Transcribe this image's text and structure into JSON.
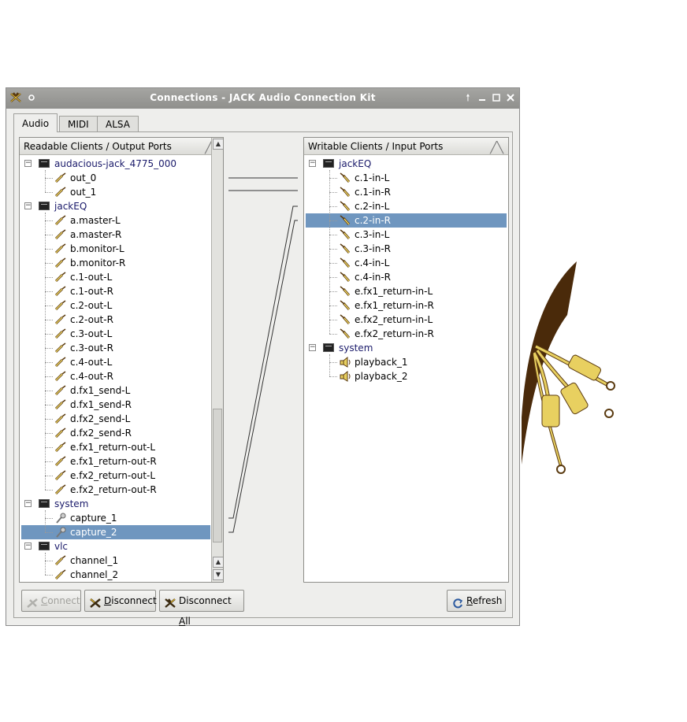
{
  "window": {
    "title": "Connections - JACK Audio Connection Kit"
  },
  "tabs": [
    {
      "label": "Audio"
    },
    {
      "label": "MIDI"
    },
    {
      "label": "ALSA"
    }
  ],
  "left_panel": {
    "header": "Readable Clients / Output Ports",
    "clients": [
      {
        "name": "audacious-jack_4775_000",
        "ports": [
          "out_0",
          "out_1"
        ]
      },
      {
        "name": "jackEQ",
        "ports": [
          "a.master-L",
          "a.master-R",
          "b.monitor-L",
          "b.monitor-R",
          "c.1-out-L",
          "c.1-out-R",
          "c.2-out-L",
          "c.2-out-R",
          "c.3-out-L",
          "c.3-out-R",
          "c.4-out-L",
          "c.4-out-R",
          "d.fx1_send-L",
          "d.fx1_send-R",
          "d.fx2_send-L",
          "d.fx2_send-R",
          "e.fx1_return-out-L",
          "e.fx1_return-out-R",
          "e.fx2_return-out-L",
          "e.fx2_return-out-R"
        ]
      },
      {
        "name": "system",
        "ports": [
          "capture_1",
          "capture_2"
        ]
      },
      {
        "name": "vlc",
        "ports": [
          "channel_1",
          "channel_2"
        ]
      }
    ],
    "selected_port": "capture_2"
  },
  "right_panel": {
    "header": "Writable Clients / Input Ports",
    "clients": [
      {
        "name": "jackEQ",
        "ports": [
          "c.1-in-L",
          "c.1-in-R",
          "c.2-in-L",
          "c.2-in-R",
          "c.3-in-L",
          "c.3-in-R",
          "c.4-in-L",
          "c.4-in-R",
          "e.fx1_return-in-L",
          "e.fx1_return-in-R",
          "e.fx2_return-in-L",
          "e.fx2_return-in-R"
        ]
      },
      {
        "name": "system",
        "ports": [
          "playback_1",
          "playback_2"
        ]
      }
    ],
    "selected_port": "c.2-in-R"
  },
  "buttons": {
    "connect": {
      "pre": "",
      "underlined": "C",
      "post": "onnect"
    },
    "disconnect": {
      "pre": "",
      "underlined": "D",
      "post": "isconnect"
    },
    "disconnect_all": {
      "pre": "Disconnect ",
      "underlined": "A",
      "post": "ll"
    },
    "refresh": {
      "pre": "",
      "underlined": "R",
      "post": "efresh"
    }
  },
  "colors": {
    "selection": "#6f96bf",
    "titlebar": "#9a9a97",
    "client_text": "#1a1a6a"
  }
}
